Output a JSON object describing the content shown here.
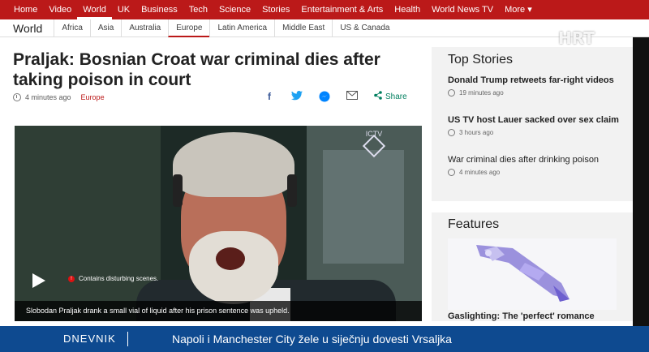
{
  "topnav": {
    "items": [
      "Home",
      "Video",
      "World",
      "UK",
      "Business",
      "Tech",
      "Science",
      "Stories",
      "Entertainment & Arts",
      "Health",
      "World News TV",
      "More ▾"
    ]
  },
  "subnav": {
    "section": "World",
    "items": [
      "Africa",
      "Asia",
      "Australia",
      "Europe",
      "Latin America",
      "Middle East",
      "US & Canada"
    ]
  },
  "overlay_logo": "HRT",
  "article": {
    "headline": "Praljak: Bosnian Croat war criminal dies after taking poison in court",
    "time": "4 minutes ago",
    "tag": "Europe",
    "share_label": "Share"
  },
  "video": {
    "channel_logo": "ICTV",
    "warning": "Contains disturbing scenes.",
    "caption": "Slobodan Praljak drank a small vial of liquid after his prison sentence was upheld."
  },
  "top_stories": {
    "title": "Top Stories",
    "stories": [
      {
        "title": "Donald Trump retweets far-right videos",
        "time": "19 minutes ago"
      },
      {
        "title": "US TV host Lauer sacked over sex claim",
        "time": "3 hours ago"
      },
      {
        "title": "War criminal dies after drinking poison",
        "time": "4 minutes ago"
      }
    ]
  },
  "features": {
    "title": "Features",
    "story": "Gaslighting: The 'perfect' romance"
  },
  "ticker": {
    "label": "DNEVNIK",
    "message": "Napoli i Manchester City žele u siječnju dovesti Vrsaljka"
  },
  "colors": {
    "brand_red": "#bb1919",
    "ticker_blue": "#0e4a90"
  }
}
